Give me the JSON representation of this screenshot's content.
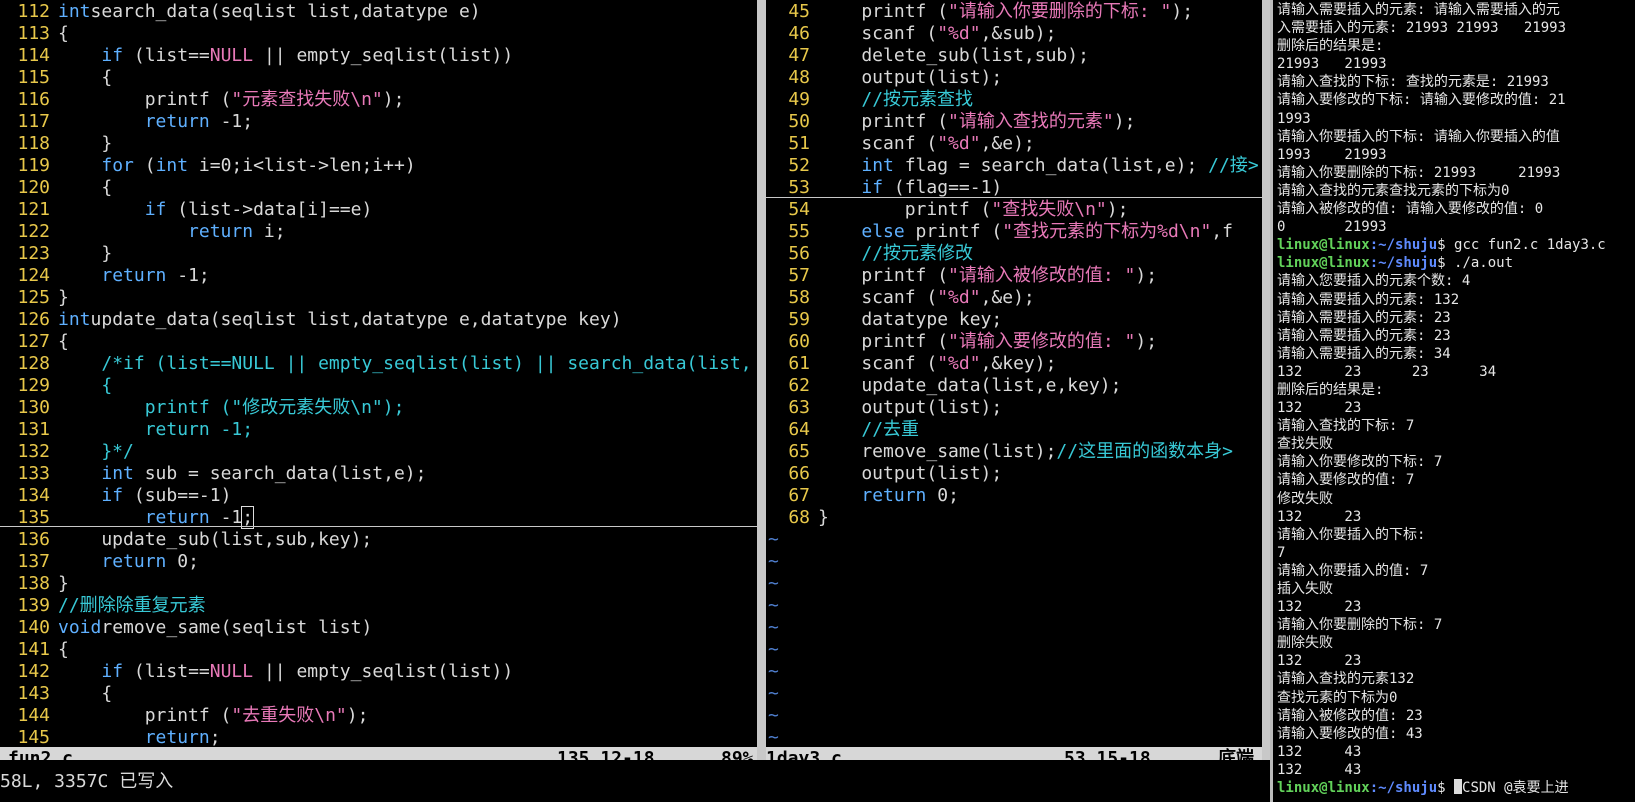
{
  "left": {
    "filename": "fun2.c",
    "position": "135,12-18",
    "percent": "89%",
    "lines": [
      {
        "n": "112",
        "t": [
          [
            "kw",
            "int"
          ],
          [
            "",
            "search_data(seqlist list,datatype e)"
          ]
        ]
      },
      {
        "n": "113",
        "t": [
          [
            "",
            "{"
          ]
        ]
      },
      {
        "n": "114",
        "t": [
          [
            "",
            "    "
          ],
          [
            "kw",
            "if"
          ],
          [
            "",
            " (list=="
          ],
          [
            "str",
            "NULL"
          ],
          [
            "",
            " || empty_seqlist(list))"
          ]
        ]
      },
      {
        "n": "115",
        "t": [
          [
            "",
            "    {"
          ]
        ]
      },
      {
        "n": "116",
        "t": [
          [
            "",
            "        printf ("
          ],
          [
            "str",
            "\"元素查找失败\\n\""
          ],
          [
            "",
            ");"
          ]
        ]
      },
      {
        "n": "117",
        "t": [
          [
            "",
            "        "
          ],
          [
            "kw",
            "return"
          ],
          [
            "",
            " -1;"
          ]
        ]
      },
      {
        "n": "118",
        "t": [
          [
            "",
            "    }"
          ]
        ]
      },
      {
        "n": "119",
        "t": [
          [
            "",
            "    "
          ],
          [
            "kw",
            "for"
          ],
          [
            "",
            " ("
          ],
          [
            "kw",
            "int"
          ],
          [
            "",
            " i=0;i<list->len;i++)"
          ]
        ]
      },
      {
        "n": "120",
        "t": [
          [
            "",
            "    {"
          ]
        ]
      },
      {
        "n": "121",
        "t": [
          [
            "",
            "        "
          ],
          [
            "kw",
            "if"
          ],
          [
            "",
            " (list->data[i]==e)"
          ]
        ]
      },
      {
        "n": "122",
        "t": [
          [
            "",
            "            "
          ],
          [
            "kw",
            "return"
          ],
          [
            "",
            " i;"
          ]
        ]
      },
      {
        "n": "123",
        "t": [
          [
            "",
            "    }"
          ]
        ]
      },
      {
        "n": "124",
        "t": [
          [
            "",
            "    "
          ],
          [
            "kw",
            "return"
          ],
          [
            "",
            " -1;"
          ]
        ]
      },
      {
        "n": "125",
        "t": [
          [
            "",
            "}"
          ]
        ]
      },
      {
        "n": "126",
        "t": [
          [
            "kw",
            "int"
          ],
          [
            "",
            "update_data(seqlist list,datatype e,datatype key)"
          ]
        ]
      },
      {
        "n": "127",
        "t": [
          [
            "",
            "{"
          ]
        ]
      },
      {
        "n": "128",
        "t": [
          [
            "",
            "    "
          ],
          [
            "cmt",
            "/*if (list==NULL || empty_seqlist(list) || search_data(list,"
          ]
        ]
      },
      {
        "n": "129",
        "t": [
          [
            "cmt",
            "    {"
          ]
        ]
      },
      {
        "n": "130",
        "t": [
          [
            "cmt",
            "        printf (\"修改元素失败\\n\");"
          ]
        ]
      },
      {
        "n": "131",
        "t": [
          [
            "cmt",
            "        return -1;"
          ]
        ]
      },
      {
        "n": "132",
        "t": [
          [
            "cmt",
            "    }*/"
          ]
        ]
      },
      {
        "n": "133",
        "t": [
          [
            "",
            "    "
          ],
          [
            "kw",
            "int"
          ],
          [
            "",
            " sub = search_data(list,e);"
          ]
        ]
      },
      {
        "n": "134",
        "t": [
          [
            "",
            "    "
          ],
          [
            "kw",
            "if"
          ],
          [
            "",
            " (sub==-1)"
          ]
        ]
      },
      {
        "n": "135",
        "t": [
          [
            "",
            "        "
          ],
          [
            "kw",
            "return"
          ],
          [
            "",
            " -1"
          ],
          [
            "cursor",
            ";"
          ]
        ]
      },
      {
        "n": "136",
        "t": [
          [
            "",
            "    update_sub(list,sub,key);"
          ]
        ]
      },
      {
        "n": "137",
        "t": [
          [
            "",
            "    "
          ],
          [
            "kw",
            "return"
          ],
          [
            "",
            " 0;"
          ]
        ]
      },
      {
        "n": "138",
        "t": [
          [
            "",
            "}"
          ]
        ]
      },
      {
        "n": "139",
        "t": [
          [
            "cmt",
            "//删除除重复元素"
          ]
        ]
      },
      {
        "n": "140",
        "t": [
          [
            "kw",
            "void"
          ],
          [
            "",
            "remove_same(seqlist list)"
          ]
        ]
      },
      {
        "n": "141",
        "t": [
          [
            "",
            "{"
          ]
        ]
      },
      {
        "n": "142",
        "t": [
          [
            "",
            "    "
          ],
          [
            "kw",
            "if"
          ],
          [
            "",
            " (list=="
          ],
          [
            "str",
            "NULL"
          ],
          [
            "",
            " || empty_seqlist(list))"
          ]
        ]
      },
      {
        "n": "143",
        "t": [
          [
            "",
            "    {"
          ]
        ]
      },
      {
        "n": "144",
        "t": [
          [
            "",
            "        printf ("
          ],
          [
            "str",
            "\"去重失败\\n\""
          ],
          [
            "",
            ");"
          ]
        ]
      },
      {
        "n": "145",
        "t": [
          [
            "",
            "        "
          ],
          [
            "kw",
            "return"
          ],
          [
            "",
            ";"
          ]
        ]
      }
    ]
  },
  "mid": {
    "filename": "1day3.c",
    "position": "53,15-18",
    "percent": "底端",
    "lines": [
      {
        "n": "45",
        "t": [
          [
            "",
            "    printf ("
          ],
          [
            "str",
            "\"请输入你要删除的下标: \""
          ],
          [
            "",
            ");"
          ]
        ]
      },
      {
        "n": "46",
        "t": [
          [
            "",
            "    scanf ("
          ],
          [
            "str",
            "\"%d\""
          ],
          [
            "",
            ",&sub);"
          ]
        ]
      },
      {
        "n": "47",
        "t": [
          [
            "",
            "    delete_sub(list,sub);"
          ]
        ]
      },
      {
        "n": "48",
        "t": [
          [
            "",
            "    output(list);"
          ]
        ]
      },
      {
        "n": "49",
        "t": [
          [
            "",
            "    "
          ],
          [
            "cmt",
            "//按元素查找"
          ]
        ]
      },
      {
        "n": "50",
        "t": [
          [
            "",
            "    printf ("
          ],
          [
            "str",
            "\"请输入查找的元素\""
          ],
          [
            "",
            ");"
          ]
        ]
      },
      {
        "n": "51",
        "t": [
          [
            "",
            "    scanf ("
          ],
          [
            "str",
            "\"%d\""
          ],
          [
            "",
            ",&e);"
          ]
        ]
      },
      {
        "n": "52",
        "t": [
          [
            "",
            "    "
          ],
          [
            "kw",
            "int"
          ],
          [
            "",
            " flag = search_data(list,e); "
          ],
          [
            "cmt",
            "//接>"
          ]
        ]
      },
      {
        "n": "53",
        "t": [
          [
            "",
            "    "
          ],
          [
            "kw",
            "if"
          ],
          [
            "",
            " (flag==-1)"
          ]
        ]
      },
      {
        "n": "54",
        "t": [
          [
            "",
            "        printf ("
          ],
          [
            "str",
            "\"查找失败\\n\""
          ],
          [
            "",
            ");"
          ]
        ]
      },
      {
        "n": "55",
        "t": [
          [
            "",
            "    "
          ],
          [
            "kw",
            "else"
          ],
          [
            "",
            " printf ("
          ],
          [
            "str",
            "\"查找元素的下标为%d\\n\""
          ],
          [
            "",
            ",f"
          ]
        ]
      },
      {
        "n": "56",
        "t": [
          [
            "",
            "    "
          ],
          [
            "cmt",
            "//按元素修改"
          ]
        ]
      },
      {
        "n": "57",
        "t": [
          [
            "",
            "    printf ("
          ],
          [
            "str",
            "\"请输入被修改的值: \""
          ],
          [
            "",
            ");"
          ]
        ]
      },
      {
        "n": "58",
        "t": [
          [
            "",
            "    scanf ("
          ],
          [
            "str",
            "\"%d\""
          ],
          [
            "",
            ",&e);"
          ]
        ]
      },
      {
        "n": "59",
        "t": [
          [
            "",
            "    datatype key;"
          ]
        ]
      },
      {
        "n": "60",
        "t": [
          [
            "",
            "    printf ("
          ],
          [
            "str",
            "\"请输入要修改的值: \""
          ],
          [
            "",
            ");"
          ]
        ]
      },
      {
        "n": "61",
        "t": [
          [
            "",
            "    scanf ("
          ],
          [
            "str",
            "\"%d\""
          ],
          [
            "",
            ",&key);"
          ]
        ]
      },
      {
        "n": "62",
        "t": [
          [
            "",
            "    update_data(list,e,key);"
          ]
        ]
      },
      {
        "n": "63",
        "t": [
          [
            "",
            "    output(list);"
          ]
        ]
      },
      {
        "n": "64",
        "t": [
          [
            "",
            "    "
          ],
          [
            "cmt",
            "//去重"
          ]
        ]
      },
      {
        "n": "65",
        "t": [
          [
            "",
            "    remove_same(list);"
          ],
          [
            "cmt",
            "//这里面的函数本身>"
          ]
        ]
      },
      {
        "n": "66",
        "t": [
          [
            "",
            "    output(list);"
          ]
        ]
      },
      {
        "n": "67",
        "t": [
          [
            "",
            "    "
          ],
          [
            "kw",
            "return"
          ],
          [
            "",
            " 0;"
          ]
        ]
      },
      {
        "n": "68",
        "t": [
          [
            "",
            "}"
          ]
        ]
      }
    ],
    "tildes": 10
  },
  "cmdline": "58L, 3357C 已写入",
  "terminal": {
    "lines": [
      "请输入需要插入的元素: 请输入需要插入的元",
      "入需要插入的元素: 21993 21993   21993",
      "删除后的结果是:",
      "21993   21993",
      "请输入查找的下标: 查找的元素是: 21993",
      "请输入要修改的下标: 请输入要修改的值: 21",
      "1993",
      "请输入你要插入的下标: 请输入你要插入的值",
      "1993    21993",
      "请输入你要删除的下标: 21993     21993",
      "请输入查找的元素查找元素的下标为0",
      "请输入被修改的值: 请输入要修改的值: 0",
      "0       21993"
    ],
    "prompt_user": "linux@linux",
    "prompt_path": ":~/shuju",
    "prompt_cmd1": "$ gcc fun2.c 1day3.c",
    "prompt_cmd2": "$ ./a.out",
    "lines2": [
      "请输入您要插入的元素个数: 4",
      "请输入需要插入的元素: 132",
      "请输入需要插入的元素: 23",
      "请输入需要插入的元素: 23",
      "请输入需要插入的元素: 34",
      "132     23      23      34",
      "删除后的结果是:",
      "132     23",
      "请输入查找的下标: 7",
      "查找失败",
      "请输入你要修改的下标: 7",
      "请输入要修改的值: 7",
      "修改失败",
      "132     23",
      "请输入你要插入的下标:",
      "7",
      "请输入你要插入的值: 7",
      "插入失败",
      "132     23",
      "请输入你要删除的下标: 7",
      "删除失败",
      "132     23",
      "请输入查找的元素132",
      "查找元素的下标为0",
      "请输入被修改的值: 23",
      "请输入要修改的值: 43",
      "132     43",
      "132     43"
    ],
    "prompt_cmd3": "$ ",
    "watermark": "CSDN @袁要上进"
  }
}
